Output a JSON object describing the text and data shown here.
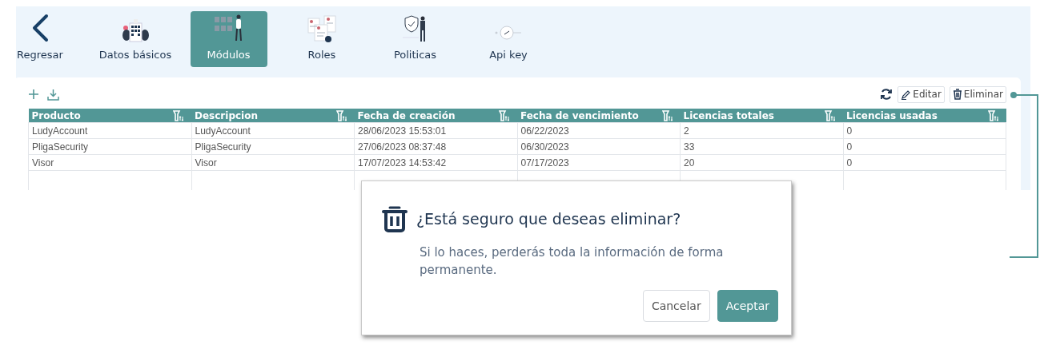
{
  "tabs": [
    {
      "label": "Regresar",
      "kind": "back",
      "selected": false
    },
    {
      "label": "Datos básicos",
      "kind": "building",
      "selected": false
    },
    {
      "label": "Módulos",
      "kind": "modules",
      "selected": true
    },
    {
      "label": "Roles",
      "kind": "documents",
      "selected": false
    },
    {
      "label": "Politicas",
      "kind": "shield",
      "selected": false
    },
    {
      "label": "Api key",
      "kind": "key",
      "selected": false
    }
  ],
  "toolbar": {
    "actions": [
      {
        "label": "Editar",
        "kind": "edit"
      },
      {
        "label": "Eliminar",
        "kind": "delete"
      }
    ]
  },
  "table": {
    "columns": [
      "Producto",
      "Descripcion",
      "Fecha de creación",
      "Fecha de vencimiento",
      "Licencias totales",
      "Licencias usadas"
    ],
    "rows": [
      [
        "LudyAccount",
        "LudyAccount",
        "28/06/2023 15:53:01",
        "06/22/2023",
        "2",
        "0"
      ],
      [
        "PligaSecurity",
        "PligaSecurity",
        "27/06/2023 08:37:48",
        "06/30/2023",
        "33",
        "0"
      ],
      [
        "Visor",
        "Visor",
        "17/07/2023 14:53:42",
        "07/17/2023",
        "20",
        "0"
      ]
    ]
  },
  "dialog": {
    "title": "¿Está seguro que deseas eliminar?",
    "message": "Si lo haces, perderás toda la información de forma permanente.",
    "buttons": [
      {
        "label": "Cancelar",
        "kind": "secondary"
      },
      {
        "label": "Aceptar",
        "kind": "primary"
      }
    ]
  }
}
